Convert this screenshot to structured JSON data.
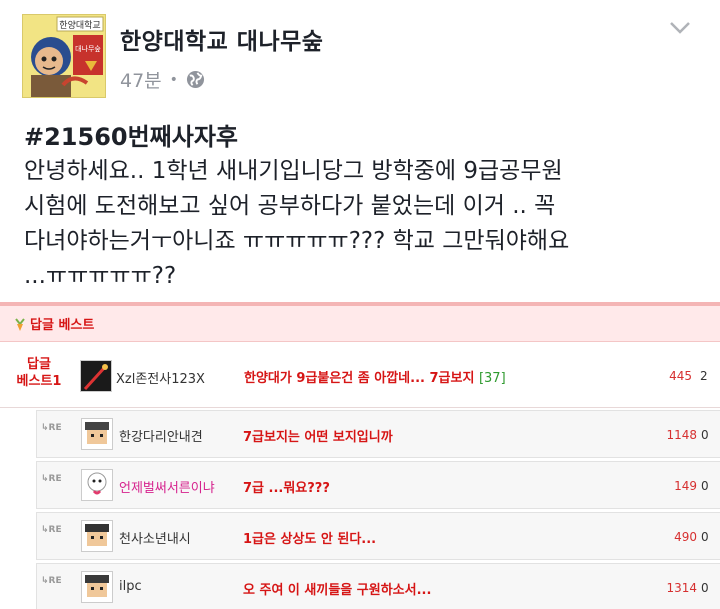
{
  "page": {
    "name": "한양대학교 대나무숲",
    "time": "47분",
    "separator": "•",
    "avatar_sign_text": "한양대학교",
    "avatar_board_text": "대나무숲"
  },
  "post": {
    "hashtag": "#21560번째사자후",
    "text": "안녕하세요.. 1학년 새내기입니당그 방학중에 9급공무원\n시험에 도전해보고 싶어 공부하다가 붙었는데 이거 .. 꼭\n다녀야하는거ㅜ아니죠 ㅠㅠㅠㅠㅠ??? 학교 그만둬야해요\n...ㅠㅠㅠㅠㅠ??"
  },
  "best": {
    "title": "답글 베스트",
    "main": {
      "label_line1": "답글",
      "label_line2": "베스트1",
      "nick": "Xzl존전사123X",
      "text": "한양대가 9급붙은건 좀 아깝네... 7급보지",
      "reply_count": "[37]",
      "up": "445",
      "down": "2"
    },
    "re_label": "RE",
    "replies": [
      {
        "nick": "한강다리안내견",
        "text": "7급보지는 어떤 보지입니까",
        "up": "1148",
        "down": "0",
        "nick_pink": false
      },
      {
        "nick": "언제벌써서른이냐",
        "text": "7급 ...뭐요???",
        "up": "149",
        "down": "0",
        "nick_pink": true
      },
      {
        "nick": "천사소년내시",
        "text": "1급은 상상도 안 된다...",
        "up": "490",
        "down": "0",
        "nick_pink": false
      },
      {
        "nick": "ilpc",
        "text": "오 주여 이 새끼들을 구원하소서...",
        "up": "1314",
        "down": "0",
        "nick_pink": false
      }
    ]
  }
}
